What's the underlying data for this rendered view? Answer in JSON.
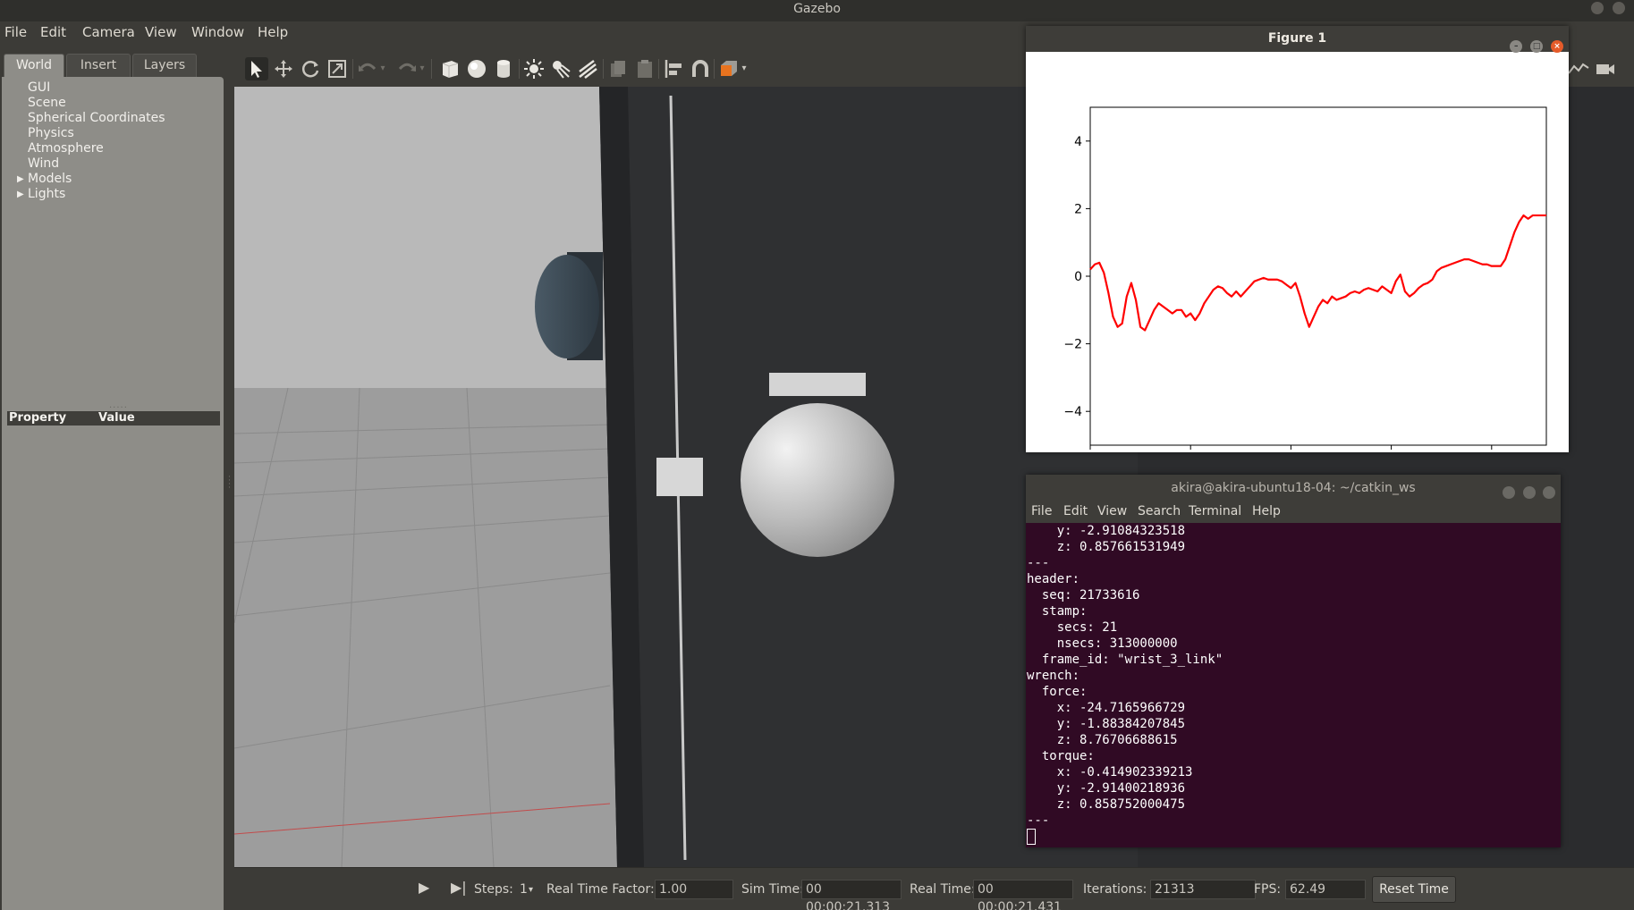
{
  "app": {
    "title": "Gazebo"
  },
  "menu": [
    "File",
    "Edit",
    "Camera",
    "View",
    "Window",
    "Help"
  ],
  "left_panel": {
    "tabs": [
      "World",
      "Insert",
      "Layers"
    ],
    "active_tab": "World",
    "world_items": [
      "GUI",
      "Scene",
      "Spherical Coordinates",
      "Physics",
      "Atmosphere",
      "Wind",
      "Models",
      "Lights"
    ],
    "property_header": {
      "property": "Property",
      "value": "Value"
    }
  },
  "toolbar_icons": [
    "select-arrow",
    "translate-cross",
    "rotate",
    "scale",
    "undo",
    "redo",
    "box",
    "sphere",
    "cylinder",
    "point-light",
    "spot-light",
    "directional-light",
    "copy",
    "paste",
    "align",
    "magnet",
    "view-angle"
  ],
  "figure": {
    "title": "Figure 1",
    "chart_data": {
      "type": "line",
      "yticks": [
        4,
        2,
        0,
        -2,
        -4
      ],
      "ylim": [
        -5,
        5
      ],
      "xlim": [
        0,
        100
      ],
      "series": [
        {
          "color": "#ff0000",
          "x": [
            0,
            1,
            2,
            3,
            4,
            5,
            6,
            7,
            8,
            9,
            10,
            11,
            12,
            13,
            14,
            15,
            16,
            17,
            18,
            19,
            20,
            21,
            22,
            23,
            24,
            25,
            26,
            27,
            28,
            29,
            30,
            31,
            32,
            33,
            34,
            35,
            36,
            37,
            38,
            39,
            40,
            41,
            42,
            43,
            44,
            45,
            46,
            47,
            48,
            49,
            50,
            51,
            52,
            53,
            54,
            55,
            56,
            57,
            58,
            59,
            60,
            61,
            62,
            63,
            64,
            65,
            66,
            67,
            68,
            69,
            70,
            71,
            72,
            73,
            74,
            75,
            76,
            77,
            78,
            79,
            80,
            81,
            82,
            83,
            84,
            85,
            86,
            87,
            88,
            89,
            90,
            91,
            92,
            93,
            94,
            95,
            96,
            97,
            98,
            99,
            100
          ],
          "y": [
            0.2,
            0.35,
            0.4,
            0.1,
            -0.5,
            -1.2,
            -1.5,
            -1.4,
            -0.6,
            -0.2,
            -0.7,
            -1.5,
            -1.6,
            -1.3,
            -1.0,
            -0.8,
            -0.9,
            -1.0,
            -1.1,
            -1.0,
            -1.0,
            -1.2,
            -1.1,
            -1.3,
            -1.1,
            -0.8,
            -0.6,
            -0.4,
            -0.3,
            -0.35,
            -0.5,
            -0.6,
            -0.45,
            -0.6,
            -0.45,
            -0.3,
            -0.15,
            -0.1,
            -0.05,
            -0.1,
            -0.1,
            -0.1,
            -0.15,
            -0.25,
            -0.35,
            -0.2,
            -0.6,
            -1.1,
            -1.5,
            -1.2,
            -0.9,
            -0.7,
            -0.8,
            -0.6,
            -0.7,
            -0.65,
            -0.6,
            -0.5,
            -0.45,
            -0.5,
            -0.4,
            -0.35,
            -0.4,
            -0.45,
            -0.3,
            -0.4,
            -0.5,
            -0.15,
            0.05,
            -0.45,
            -0.6,
            -0.5,
            -0.35,
            -0.25,
            -0.2,
            -0.1,
            0.15,
            0.25,
            0.3,
            0.35,
            0.4,
            0.45,
            0.5,
            0.5,
            0.45,
            0.4,
            0.35,
            0.35,
            0.3,
            0.3,
            0.3,
            0.5,
            0.9,
            1.3,
            1.6,
            1.8,
            1.7,
            1.8,
            1.8,
            1.8,
            1.8
          ]
        }
      ]
    }
  },
  "terminal": {
    "title": "akira@akira-ubuntu18-04: ~/catkin_ws",
    "menu": [
      "File",
      "Edit",
      "View",
      "Search",
      "Terminal",
      "Help"
    ],
    "lines": [
      "    y: -2.91084323518",
      "    z: 0.857661531949",
      "---",
      "header:",
      "  seq: 21733616",
      "  stamp:",
      "    secs: 21",
      "    nsecs: 313000000",
      "  frame_id: \"wrist_3_link\"",
      "wrench:",
      "  force:",
      "    x: -24.7165966729",
      "    y: -1.88384207845",
      "    z: 8.76706688615",
      "  torque:",
      "    x: -0.414902339213",
      "    y: -2.91400218936",
      "    z: 0.858752000475",
      "---"
    ]
  },
  "status": {
    "steps_label": "Steps:",
    "steps_value": "1",
    "rtf_label": "Real Time Factor:",
    "rtf_value": "1.00",
    "sim_label": "Sim Time:",
    "sim_value": "00 00:00:21.313",
    "real_label": "Real Time:",
    "real_value": "00 00:00:21.431",
    "iter_label": "Iterations:",
    "iter_value": "21313",
    "fps_label": "FPS:",
    "fps_value": "62.49",
    "reset_label": "Reset Time"
  }
}
